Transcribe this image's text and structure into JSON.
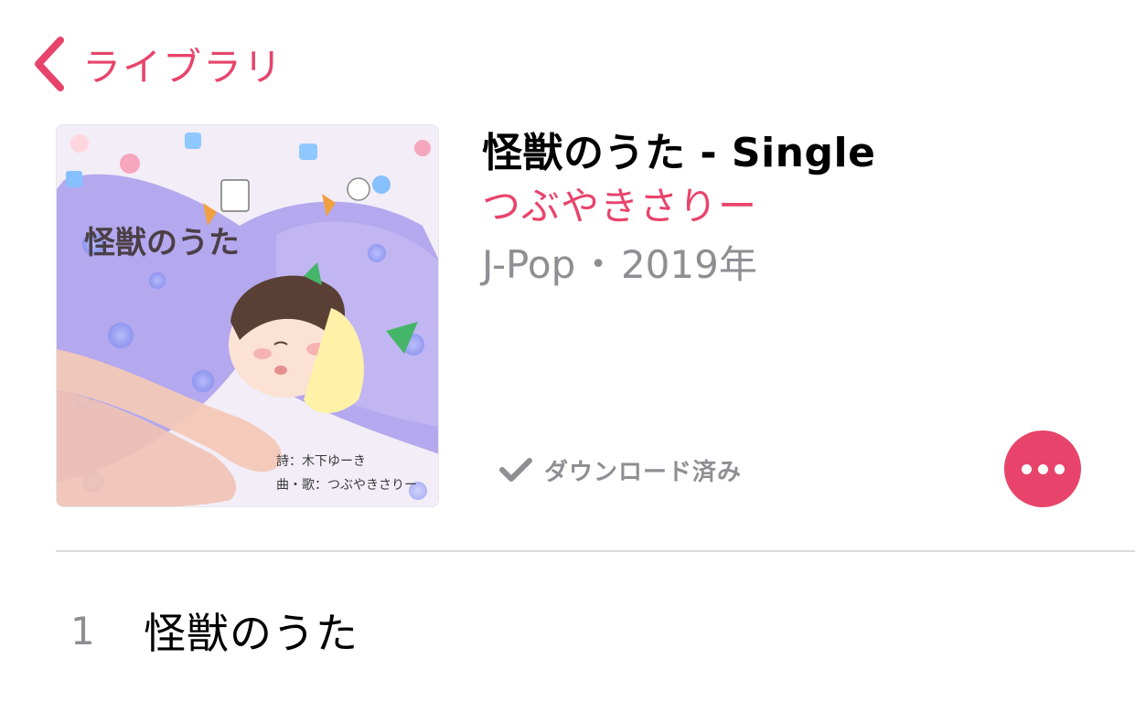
{
  "nav": {
    "back_label": "ライブラリ",
    "back_icon": "chevron-left-icon"
  },
  "album": {
    "title": "怪獣のうた - Single",
    "artist": "つぶやきさりー",
    "genre": "J-Pop",
    "separator": "•",
    "year": "2019年",
    "downloaded_label": "ダウンロード済み",
    "downloaded_icon": "checkmark-icon",
    "more_icon": "more-icon"
  },
  "artwork": {
    "title_text": "怪獣のうた",
    "credit_lyrics": "詩：木下ゆーき",
    "credit_music": "曲・歌：つぶやきさりー"
  },
  "tracks": [
    {
      "number": "1",
      "title": "怪獣のうた"
    }
  ],
  "colors": {
    "accent": "#e8446b",
    "secondary_text": "#8e8e93",
    "divider": "#dcdce0"
  }
}
